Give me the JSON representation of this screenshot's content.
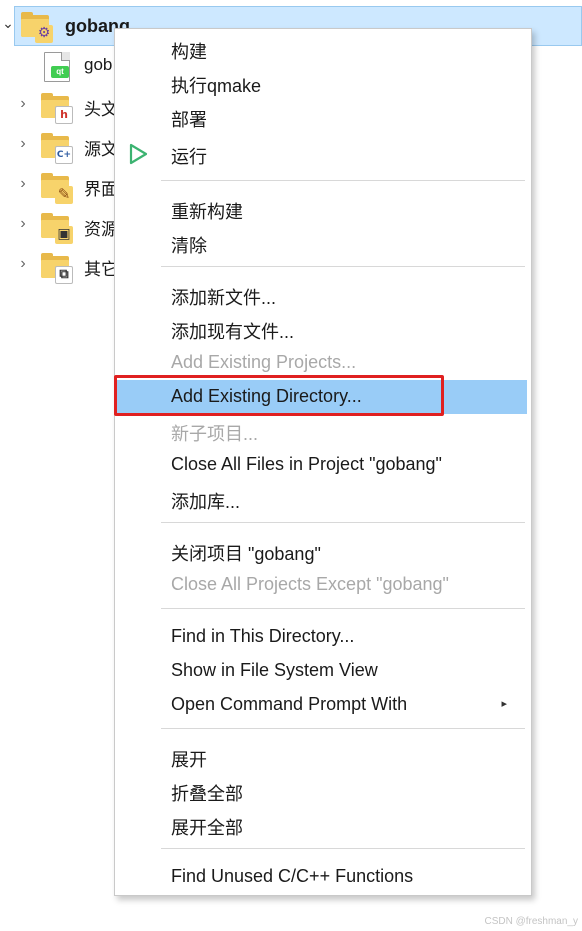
{
  "tree": {
    "root": {
      "label": "gobang",
      "chevron": "⌄"
    },
    "items": [
      {
        "label": "gob",
        "icon": "qt-project-file-icon",
        "badge": "qt"
      },
      {
        "label": "头文",
        "icon": "header-folder-icon",
        "badge": "h"
      },
      {
        "label": "源文",
        "icon": "source-folder-icon",
        "badge": "C+"
      },
      {
        "label": "界面",
        "icon": "forms-folder-icon",
        "badge": "✎"
      },
      {
        "label": "资源",
        "icon": "resources-folder-icon",
        "badge": "▣"
      },
      {
        "label": "其它",
        "icon": "other-files-folder-icon",
        "badge": "⧉"
      }
    ],
    "expander": "›"
  },
  "menu": {
    "items": [
      {
        "label": "构建",
        "enabled": true
      },
      {
        "label": "执行qmake",
        "enabled": true
      },
      {
        "label": "部署",
        "enabled": true
      },
      {
        "label": "运行",
        "enabled": true,
        "icon": "run-icon"
      },
      {
        "label": "重新构建",
        "enabled": true
      },
      {
        "label": "清除",
        "enabled": true
      },
      {
        "label": "添加新文件...",
        "enabled": true
      },
      {
        "label": "添加现有文件...",
        "enabled": true
      },
      {
        "label": "Add Existing Projects...",
        "enabled": false
      },
      {
        "label": "Add Existing Directory...",
        "enabled": true,
        "highlighted": true
      },
      {
        "label": "新子项目...",
        "enabled": false
      },
      {
        "label": "Close All Files in Project \"gobang\"",
        "enabled": true
      },
      {
        "label": "添加库...",
        "enabled": true
      },
      {
        "label": "关闭项目 \"gobang\"",
        "enabled": true
      },
      {
        "label": "Close All Projects Except \"gobang\"",
        "enabled": false
      },
      {
        "label": "Find in This Directory...",
        "enabled": true
      },
      {
        "label": "Show in File System View",
        "enabled": true
      },
      {
        "label": "Open Command Prompt With",
        "enabled": true,
        "submenu": "▸"
      },
      {
        "label": "展开",
        "enabled": true
      },
      {
        "label": "折叠全部",
        "enabled": true
      },
      {
        "label": "展开全部",
        "enabled": true
      },
      {
        "label": "Find Unused C/C++ Functions",
        "enabled": true
      }
    ]
  },
  "watermark": "CSDN @freshman_y",
  "colors": {
    "highlight": "#99ccf7",
    "selection": "#cde8ff",
    "annotation": "#e02020",
    "run": "#3cb371"
  }
}
